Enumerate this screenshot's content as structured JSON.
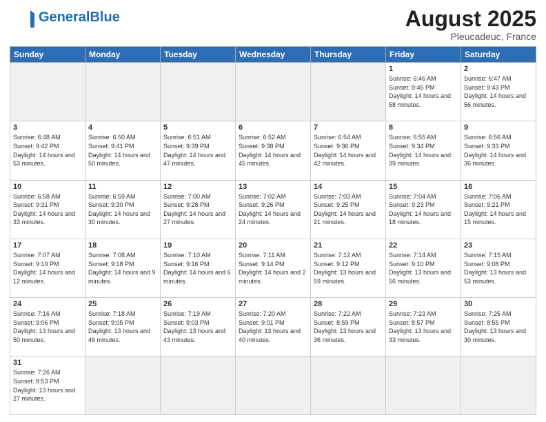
{
  "header": {
    "logo_general": "General",
    "logo_blue": "Blue",
    "month_title": "August 2025",
    "location": "Pleucadeuc, France"
  },
  "weekdays": [
    "Sunday",
    "Monday",
    "Tuesday",
    "Wednesday",
    "Thursday",
    "Friday",
    "Saturday"
  ],
  "days": [
    {
      "num": "",
      "info": "",
      "empty": true
    },
    {
      "num": "",
      "info": "",
      "empty": true
    },
    {
      "num": "",
      "info": "",
      "empty": true
    },
    {
      "num": "",
      "info": "",
      "empty": true
    },
    {
      "num": "",
      "info": "",
      "empty": true
    },
    {
      "num": "1",
      "info": "Sunrise: 6:46 AM\nSunset: 9:45 PM\nDaylight: 14 hours and 58 minutes."
    },
    {
      "num": "2",
      "info": "Sunrise: 6:47 AM\nSunset: 9:43 PM\nDaylight: 14 hours and 56 minutes."
    },
    {
      "num": "3",
      "info": "Sunrise: 6:48 AM\nSunset: 9:42 PM\nDaylight: 14 hours and 53 minutes."
    },
    {
      "num": "4",
      "info": "Sunrise: 6:50 AM\nSunset: 9:41 PM\nDaylight: 14 hours and 50 minutes."
    },
    {
      "num": "5",
      "info": "Sunrise: 6:51 AM\nSunset: 9:39 PM\nDaylight: 14 hours and 47 minutes."
    },
    {
      "num": "6",
      "info": "Sunrise: 6:52 AM\nSunset: 9:38 PM\nDaylight: 14 hours and 45 minutes."
    },
    {
      "num": "7",
      "info": "Sunrise: 6:54 AM\nSunset: 9:36 PM\nDaylight: 14 hours and 42 minutes."
    },
    {
      "num": "8",
      "info": "Sunrise: 6:55 AM\nSunset: 9:34 PM\nDaylight: 14 hours and 39 minutes."
    },
    {
      "num": "9",
      "info": "Sunrise: 6:56 AM\nSunset: 9:33 PM\nDaylight: 14 hours and 36 minutes."
    },
    {
      "num": "10",
      "info": "Sunrise: 6:58 AM\nSunset: 9:31 PM\nDaylight: 14 hours and 33 minutes."
    },
    {
      "num": "11",
      "info": "Sunrise: 6:59 AM\nSunset: 9:30 PM\nDaylight: 14 hours and 30 minutes."
    },
    {
      "num": "12",
      "info": "Sunrise: 7:00 AM\nSunset: 9:28 PM\nDaylight: 14 hours and 27 minutes."
    },
    {
      "num": "13",
      "info": "Sunrise: 7:02 AM\nSunset: 9:26 PM\nDaylight: 14 hours and 24 minutes."
    },
    {
      "num": "14",
      "info": "Sunrise: 7:03 AM\nSunset: 9:25 PM\nDaylight: 14 hours and 21 minutes."
    },
    {
      "num": "15",
      "info": "Sunrise: 7:04 AM\nSunset: 9:23 PM\nDaylight: 14 hours and 18 minutes."
    },
    {
      "num": "16",
      "info": "Sunrise: 7:06 AM\nSunset: 9:21 PM\nDaylight: 14 hours and 15 minutes."
    },
    {
      "num": "17",
      "info": "Sunrise: 7:07 AM\nSunset: 9:19 PM\nDaylight: 14 hours and 12 minutes."
    },
    {
      "num": "18",
      "info": "Sunrise: 7:08 AM\nSunset: 9:18 PM\nDaylight: 14 hours and 9 minutes."
    },
    {
      "num": "19",
      "info": "Sunrise: 7:10 AM\nSunset: 9:16 PM\nDaylight: 14 hours and 6 minutes."
    },
    {
      "num": "20",
      "info": "Sunrise: 7:11 AM\nSunset: 9:14 PM\nDaylight: 14 hours and 2 minutes."
    },
    {
      "num": "21",
      "info": "Sunrise: 7:12 AM\nSunset: 9:12 PM\nDaylight: 13 hours and 59 minutes."
    },
    {
      "num": "22",
      "info": "Sunrise: 7:14 AM\nSunset: 9:10 PM\nDaylight: 13 hours and 56 minutes."
    },
    {
      "num": "23",
      "info": "Sunrise: 7:15 AM\nSunset: 9:08 PM\nDaylight: 13 hours and 53 minutes."
    },
    {
      "num": "24",
      "info": "Sunrise: 7:16 AM\nSunset: 9:06 PM\nDaylight: 13 hours and 50 minutes."
    },
    {
      "num": "25",
      "info": "Sunrise: 7:18 AM\nSunset: 9:05 PM\nDaylight: 13 hours and 46 minutes."
    },
    {
      "num": "26",
      "info": "Sunrise: 7:19 AM\nSunset: 9:03 PM\nDaylight: 13 hours and 43 minutes."
    },
    {
      "num": "27",
      "info": "Sunrise: 7:20 AM\nSunset: 9:01 PM\nDaylight: 13 hours and 40 minutes."
    },
    {
      "num": "28",
      "info": "Sunrise: 7:22 AM\nSunset: 8:59 PM\nDaylight: 13 hours and 36 minutes."
    },
    {
      "num": "29",
      "info": "Sunrise: 7:23 AM\nSunset: 8:57 PM\nDaylight: 13 hours and 33 minutes."
    },
    {
      "num": "30",
      "info": "Sunrise: 7:25 AM\nSunset: 8:55 PM\nDaylight: 13 hours and 30 minutes."
    },
    {
      "num": "31",
      "info": "Sunrise: 7:26 AM\nSunset: 8:53 PM\nDaylight: 13 hours and 27 minutes."
    }
  ]
}
